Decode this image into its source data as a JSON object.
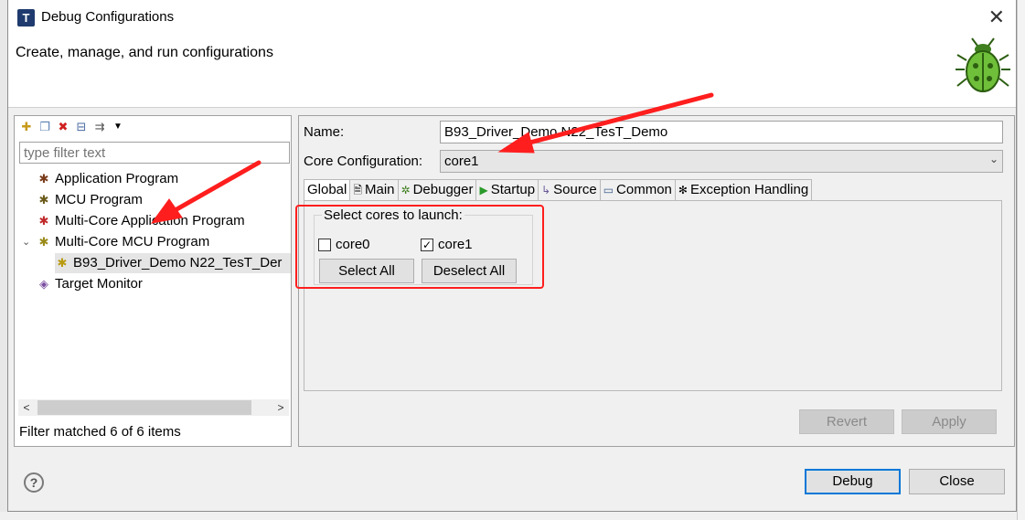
{
  "window": {
    "title": "Debug Configurations",
    "app_icon_letter": "T"
  },
  "header": {
    "message": "Create, manage, and run configurations"
  },
  "left": {
    "filter_placeholder": "type filter text",
    "tree": [
      {
        "label": "Application Program",
        "icon": "bug-icon"
      },
      {
        "label": "MCU Program",
        "icon": "bug-icon"
      },
      {
        "label": "Multi-Core Application Program",
        "icon": "bug-red-icon"
      },
      {
        "label": "Multi-Core MCU Program",
        "icon": "bug-icon",
        "expanded": true
      },
      {
        "label": "B93_Driver_Demo N22_TesT_Der",
        "icon": "bug-yellow-icon",
        "child": true,
        "selected": true
      },
      {
        "label": "Target Monitor",
        "icon": "monitor-icon"
      }
    ],
    "filter_status": "Filter matched 6 of 6 items"
  },
  "right": {
    "name_label": "Name:",
    "name_value": "B93_Driver_Demo N22_TesT_Demo",
    "core_config_label": "Core Configuration:",
    "core_config_value": "core1",
    "tabs": [
      {
        "label": "Global",
        "icon": "",
        "active": true
      },
      {
        "label": "Main",
        "icon": "page-icon"
      },
      {
        "label": "Debugger",
        "icon": "gear-bug-icon"
      },
      {
        "label": "Startup",
        "icon": "play-icon"
      },
      {
        "label": "Source",
        "icon": "source-icon"
      },
      {
        "label": "Common",
        "icon": "common-icon"
      },
      {
        "label": "Exception Handling",
        "icon": "gear-icon"
      }
    ],
    "group_title": "Select cores to launch:",
    "cores": [
      {
        "label": "core0",
        "checked": false
      },
      {
        "label": "core1",
        "checked": true
      }
    ],
    "select_all": "Select All",
    "deselect_all": "Deselect All",
    "revert": "Revert",
    "apply": "Apply"
  },
  "footer": {
    "debug": "Debug",
    "close": "Close",
    "help": "?"
  },
  "colors": {
    "annotation_red": "#ff1e1e",
    "default_button_border": "#0078d7"
  }
}
